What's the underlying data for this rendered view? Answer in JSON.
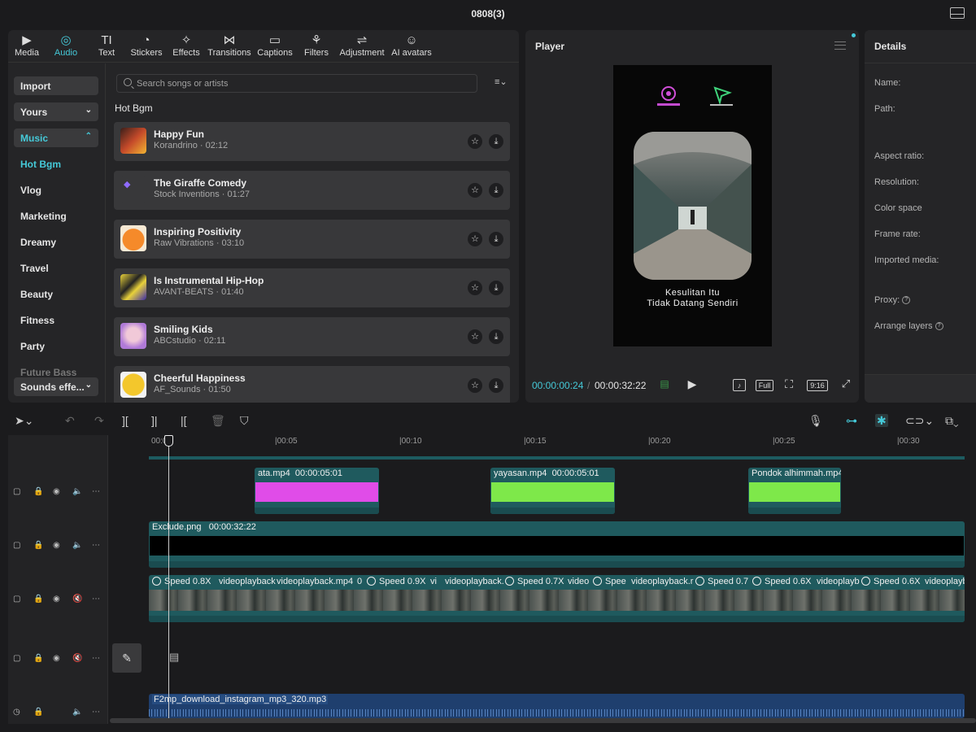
{
  "window": {
    "title": "0808(3)"
  },
  "tabs": [
    {
      "label": "Media",
      "icon": "media-icon",
      "glyph": "▶"
    },
    {
      "label": "Audio",
      "icon": "audio-icon",
      "glyph": "◎"
    },
    {
      "label": "Text",
      "icon": "text-icon",
      "glyph": "TI"
    },
    {
      "label": "Stickers",
      "icon": "stickers-icon",
      "glyph": "◔"
    },
    {
      "label": "Effects",
      "icon": "effects-icon",
      "glyph": "✧"
    },
    {
      "label": "Transitions",
      "icon": "transitions-icon",
      "glyph": "⋈"
    },
    {
      "label": "Captions",
      "icon": "captions-icon",
      "glyph": "▭"
    },
    {
      "label": "Filters",
      "icon": "filters-icon",
      "glyph": "⚘"
    },
    {
      "label": "Adjustment",
      "icon": "adjustment-icon",
      "glyph": "⇌"
    },
    {
      "label": "AI avatars",
      "icon": "ai-avatars-icon",
      "glyph": "☺"
    }
  ],
  "active_tab": "Audio",
  "side_nav": {
    "import": "Import",
    "yours": "Yours",
    "music": "Music",
    "items": [
      "Hot Bgm",
      "Vlog",
      "Marketing",
      "Dreamy",
      "Travel",
      "Beauty",
      "Fitness",
      "Party",
      "Future Bass"
    ],
    "sounds": "Sounds effe..."
  },
  "search": {
    "placeholder": "Search songs or artists"
  },
  "section_title": "Hot Bgm",
  "tracks": [
    {
      "title": "Happy Fun",
      "meta": "Korandrino · 02:12"
    },
    {
      "title": "The Giraffe Comedy",
      "meta": "Stock Inventions · 01:27"
    },
    {
      "title": "Inspiring Positivity",
      "meta": "Raw Vibrations · 03:10"
    },
    {
      "title": "Is Instrumental Hip-Hop",
      "meta": "AVANT-BEATS · 01:40"
    },
    {
      "title": "Smiling Kids",
      "meta": "ABCstudio · 02:11"
    },
    {
      "title": "Cheerful Happiness",
      "meta": "AF_Sounds · 01:50"
    }
  ],
  "player": {
    "title": "Player",
    "caption_line1": "Kesulitan Itu",
    "caption_line2": "Tidak Datang Sendiri",
    "current_time": "00:00:00:24",
    "total_time": "00:00:32:22",
    "separator": "/",
    "full_btn": "Full",
    "ratio_btn": "9:16"
  },
  "details": {
    "title": "Details",
    "labels": [
      "Name:",
      "Path:",
      "Aspect ratio:",
      "Resolution:",
      "Color space",
      "Frame rate:",
      "Imported media:",
      "Proxy:",
      "Arrange layers"
    ]
  },
  "timeline": {
    "ruler": [
      "00:00",
      "|00:05",
      "|00:10",
      "|00:15",
      "|00:20",
      "|00:25",
      "|00:30"
    ],
    "overlay_clips": [
      {
        "name": "ata.mp4",
        "duration": "00:00:05:01",
        "color": "#e04ce8"
      },
      {
        "name": "yayasan.mp4",
        "duration": "00:00:05:01",
        "color": "#7ee84a"
      },
      {
        "name": "Pondok alhimmah.mp4",
        "duration": "",
        "color": "#7ee84a"
      }
    ],
    "image_clip": {
      "name": "Exclude.png",
      "duration": "00:00:32:22"
    },
    "main_labels": [
      "Speed 0.8X",
      "videoplayback",
      "videoplayback.mp4",
      "0",
      "Speed 0.9X",
      "vi",
      "videoplayback.",
      "Speed 0.7X",
      "video",
      "Spee",
      "videoplayback.r",
      "Speed 0.7",
      "Speed 0.6X",
      "videoplayb",
      "Speed 0.6X",
      "videoplayb"
    ],
    "audio_clip": "F2mp_download_instagram_mp3_320.mp3"
  },
  "colors": {
    "accent": "#45c9d8",
    "panel": "#252527",
    "bg": "#1b1b1d",
    "audio_clip": "#1f3f6e"
  }
}
